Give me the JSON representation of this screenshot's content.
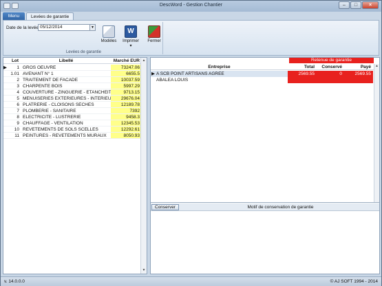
{
  "window": {
    "title": "DescWord - Gestion Chantier"
  },
  "tabs": {
    "menu": "Menu",
    "active": "Levées de garantie"
  },
  "ribbon": {
    "date_label": "Date de la levée",
    "date_value": "05/12/2014",
    "group_caption": "Levées de garantie",
    "buttons": {
      "modeles": "Modèles",
      "imprimer": "Imprimer",
      "fermer": "Fermer"
    }
  },
  "lots_table": {
    "headers": {
      "lot": "Lot",
      "libelle": "Libellé",
      "marche": "Marché EUR"
    },
    "rows": [
      {
        "lot": "1",
        "libelle": "GROS OEUVRE",
        "marche": "73247.06"
      },
      {
        "lot": "1.01",
        "libelle": "AVENANT N° 1",
        "marche": "6655.5"
      },
      {
        "lot": "2",
        "libelle": "TRAITEMENT DE FACADE",
        "marche": "10037.59"
      },
      {
        "lot": "3",
        "libelle": "CHARPENTE BOIS",
        "marche": "5997.29"
      },
      {
        "lot": "4",
        "libelle": "COUVERTURE - ZINGUERIE - ETANCHEITE",
        "marche": "9713.15"
      },
      {
        "lot": "5",
        "libelle": "MENUISERIES EXTERIEURES - INTERIEURES",
        "marche": "29676.04"
      },
      {
        "lot": "6",
        "libelle": "PLATRERIE - CLOISONS SECHES",
        "marche": "12189.78"
      },
      {
        "lot": "7",
        "libelle": "PLOMBERIE - SANITAIRE",
        "marche": "7392"
      },
      {
        "lot": "8",
        "libelle": "ELECTRICITE - LUSTRERIE",
        "marche": "9458.3"
      },
      {
        "lot": "9",
        "libelle": "CHAUFFAGE - VENTILATION",
        "marche": "12345.53"
      },
      {
        "lot": "10",
        "libelle": "REVETEMENTS DE SOLS SCELLES",
        "marche": "12292.61"
      },
      {
        "lot": "11",
        "libelle": "PEINTURES - REVETEMENTS MURAUX",
        "marche": "8050.93"
      }
    ]
  },
  "retenue": {
    "band_label": "Retenue de garantie",
    "headers": {
      "entreprise": "Entreprise",
      "total": "Total",
      "conserve": "Conservé",
      "paye": "Payé"
    },
    "rows": [
      {
        "entreprise": "A SCB POINT ARTISANS AGREE",
        "total": "2569.55",
        "conserve": "0",
        "paye": "2569.55"
      },
      {
        "entreprise": "ABALEA LOUIS",
        "total": "",
        "conserve": "",
        "paye": ""
      }
    ]
  },
  "conservation": {
    "button": "Conserver",
    "title": "Motif de conservation de garantie"
  },
  "status": {
    "version": "v. 14.0.0.0",
    "copyright": "© AJ SOFT 1994 - 2014"
  },
  "colors": {
    "retenue_red": "#e8211e",
    "marche_yellow": "#ffff8a",
    "menu_blue": "#2f62a3"
  }
}
